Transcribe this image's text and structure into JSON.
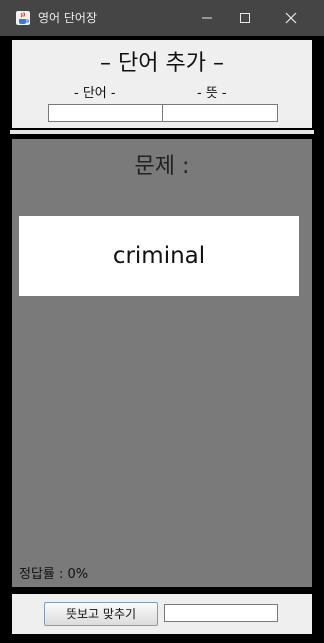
{
  "window": {
    "title": "영어 단어장",
    "icons": {
      "app": "java-coffee-icon",
      "minimize": "minimize-icon",
      "maximize": "maximize-icon",
      "close": "close-icon"
    }
  },
  "add_panel": {
    "heading": "– 단어 추가 –",
    "word_label": "- 단어 -",
    "meaning_label": "- 뜻 -",
    "word_value": "",
    "meaning_value": ""
  },
  "quiz": {
    "title": "문제 :",
    "word": "criminal",
    "accuracy": "정답률 : 0%"
  },
  "bottom": {
    "check_button": "뜻보고 맞추기",
    "answer_value": ""
  },
  "colors": {
    "titlebar": "#454545",
    "quiz_background": "#7a7a7a",
    "panel_background": "#efefef"
  }
}
